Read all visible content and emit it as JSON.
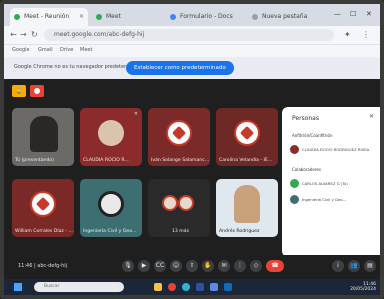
{
  "browser": {
    "tabs": [
      {
        "label": "Meet - Reunión"
      },
      {
        "label": "Meet"
      },
      {
        "label": "Formulario - Docs"
      },
      {
        "label": "Nueva pestaña"
      }
    ],
    "url": "meet.google.com/abc-defg-hij",
    "bookmarks": [
      "Google",
      "Gmail",
      "Drive",
      "Meet"
    ]
  },
  "promo": {
    "text": "Google Chrome no es tu navegador predeterminado",
    "button_label": "Establecer como predeterminado"
  },
  "tiles": [
    {
      "name": "Tú (presentando)"
    },
    {
      "name": "CLAUDIA ROCIO R..."
    },
    {
      "name": "Iván Solange Salamanc..."
    },
    {
      "name": "Carolina Velandia - IE..."
    },
    {
      "name": "William Corrales Díaz - ..."
    },
    {
      "name": "Ingeniería Civil y Geo..."
    },
    {
      "name": "13 más"
    },
    {
      "name": "Andrés Rodríguez"
    }
  ],
  "participants_panel": {
    "title": "Personas",
    "section_host": "Anfitrión/Coanfitrión",
    "host_name": "CLAUDIA ROCIO RODRIGUEZ RIVEA",
    "section_others": "Colaboradores",
    "others": [
      "CARLOS ALVAREZ G (Tú)",
      "Ingeniería Civil y Geo..."
    ]
  },
  "meeting": {
    "time": "11:46",
    "code": "abc-defg-hij"
  },
  "taskbar": {
    "search_placeholder": "Buscar",
    "time": "11:46",
    "date": "20/05/2024"
  },
  "colors": {
    "accent": "#1a73e8",
    "end_call": "#ea4335",
    "lock": "#f9ab00"
  }
}
